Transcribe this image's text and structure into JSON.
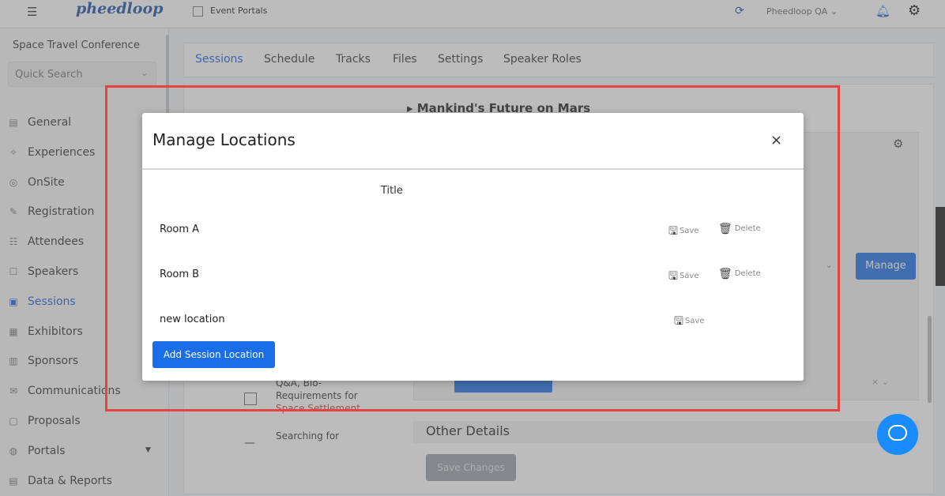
{
  "topbar": {
    "menu_icon": "menu-icon",
    "logo_text": "pheedloop",
    "portal_label": "Event Portals",
    "account_label": "Pheedloop QA",
    "account_chevron": "⌄"
  },
  "sidebar": {
    "event_name": "Space Travel Conference",
    "search_placeholder": "Quick Search",
    "items": [
      {
        "label": "General",
        "icon": "▤"
      },
      {
        "label": "Experiences",
        "icon": "✧"
      },
      {
        "label": "OnSite",
        "icon": "◎"
      },
      {
        "label": "Registration",
        "icon": "✎"
      },
      {
        "label": "Attendees",
        "icon": "☷"
      },
      {
        "label": "Speakers",
        "icon": "☐"
      },
      {
        "label": "Sessions",
        "icon": "▣"
      },
      {
        "label": "Exhibitors",
        "icon": "▦"
      },
      {
        "label": "Sponsors",
        "icon": "▥"
      },
      {
        "label": "Communications",
        "icon": "✉"
      },
      {
        "label": "Proposals",
        "icon": "▢"
      },
      {
        "label": "Portals",
        "icon": "◍"
      },
      {
        "label": "Data & Reports",
        "icon": "▤"
      }
    ],
    "active_item": "Sessions",
    "accent_color": "#1a5fd8"
  },
  "main": {
    "tabs": [
      "Sessions",
      "Schedule",
      "Tracks",
      "Files",
      "Settings",
      "Speaker Roles"
    ],
    "active_tab": "Sessions",
    "session_title": "▸ Mankind's Future on Mars",
    "manage_label": "Manage",
    "row1_text": "Q&A, Bio-Requirements for",
    "row1_link": "Space Settlement",
    "row2_text": "Searching for",
    "other_details": "Other Details",
    "save_changes": "Save Changes"
  },
  "modal": {
    "title": "Manage Locations",
    "close_icon": "×",
    "column_title": "Title",
    "rows": [
      {
        "name": "Room A",
        "save_label": "Save",
        "delete_label": "Delete"
      },
      {
        "name": "Room B",
        "save_label": "Save",
        "delete_label": "Delete"
      },
      {
        "name": "new location",
        "save_label": "Save"
      }
    ],
    "add_button": "Add Session Location",
    "button_color": "#1a6fe8"
  },
  "highlight_color": "#e84343"
}
